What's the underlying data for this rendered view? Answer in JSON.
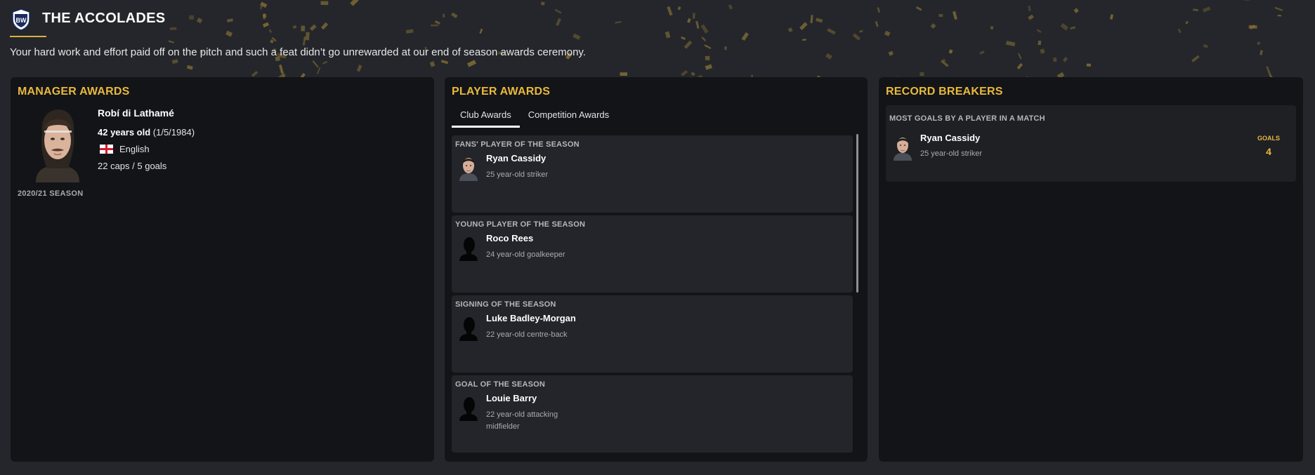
{
  "header": {
    "title": "THE ACCOLADES",
    "intro": "Your hard work and effort paid off on the pitch and such a feat didn’t go unrewarded at our end of season awards ceremony.",
    "crest_icon": "club-crest-icon"
  },
  "colors": {
    "background": "#24262b",
    "panel": "#121418",
    "card": "#23252a",
    "accent": "#e9b93c",
    "confetti": "#8c7534"
  },
  "manager": {
    "panel_title": "MANAGER AWARDS",
    "name": "Robí di Lathamé",
    "age_label": "42 years old",
    "dob": "(1/5/1984)",
    "nationality": "English",
    "flag_icon": "england-flag-icon",
    "caps": "22 caps / 5 goals",
    "season": "2020/21 SEASON"
  },
  "player_awards": {
    "panel_title": "PLAYER AWARDS",
    "tabs": [
      {
        "label": "Club Awards",
        "active": true
      },
      {
        "label": "Competition Awards",
        "active": false
      }
    ],
    "awards": [
      {
        "category": "FANS' PLAYER OF THE SEASON",
        "name": "Ryan Cassidy",
        "desc": "25 year-old striker",
        "photo": "player-face"
      },
      {
        "category": "YOUNG PLAYER OF THE SEASON",
        "name": "Roco Rees",
        "desc": "24 year-old goalkeeper",
        "photo": "silhouette"
      },
      {
        "category": "SIGNING OF THE SEASON",
        "name": "Luke Badley-Morgan",
        "desc": "22 year-old centre-back",
        "photo": "silhouette"
      },
      {
        "category": "GOAL OF THE SEASON",
        "name": "Louie Barry",
        "desc": "22 year-old attacking midfielder",
        "photo": "silhouette"
      }
    ]
  },
  "records": {
    "panel_title": "RECORD BREAKERS",
    "items": [
      {
        "category": "MOST GOALS BY A PLAYER IN A MATCH",
        "name": "Ryan Cassidy",
        "desc": "25 year-old striker",
        "stat_label": "GOALS",
        "stat_value": "4",
        "photo": "player-face"
      }
    ]
  }
}
